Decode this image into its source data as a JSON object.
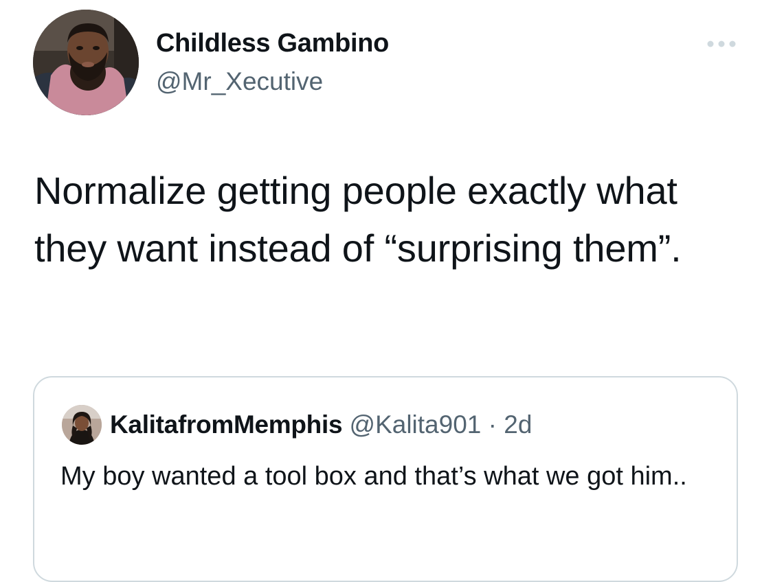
{
  "tweet": {
    "author": {
      "name": "Childless Gambino",
      "handle": "@Mr_Xecutive"
    },
    "more_icon": "more-horizontal-icon",
    "text": "Normalize getting people exactly what they want instead of “surprising them”.",
    "quote": {
      "author_name": "KalitafromMemphis",
      "author_handle": "@Kalita901",
      "separator": "·",
      "time": "2d",
      "text": "My boy wanted a tool box and that’s what we got him.."
    }
  },
  "colors": {
    "text_primary": "#0f1419",
    "text_secondary": "#536471",
    "border": "#cfd9de",
    "background": "#ffffff"
  }
}
